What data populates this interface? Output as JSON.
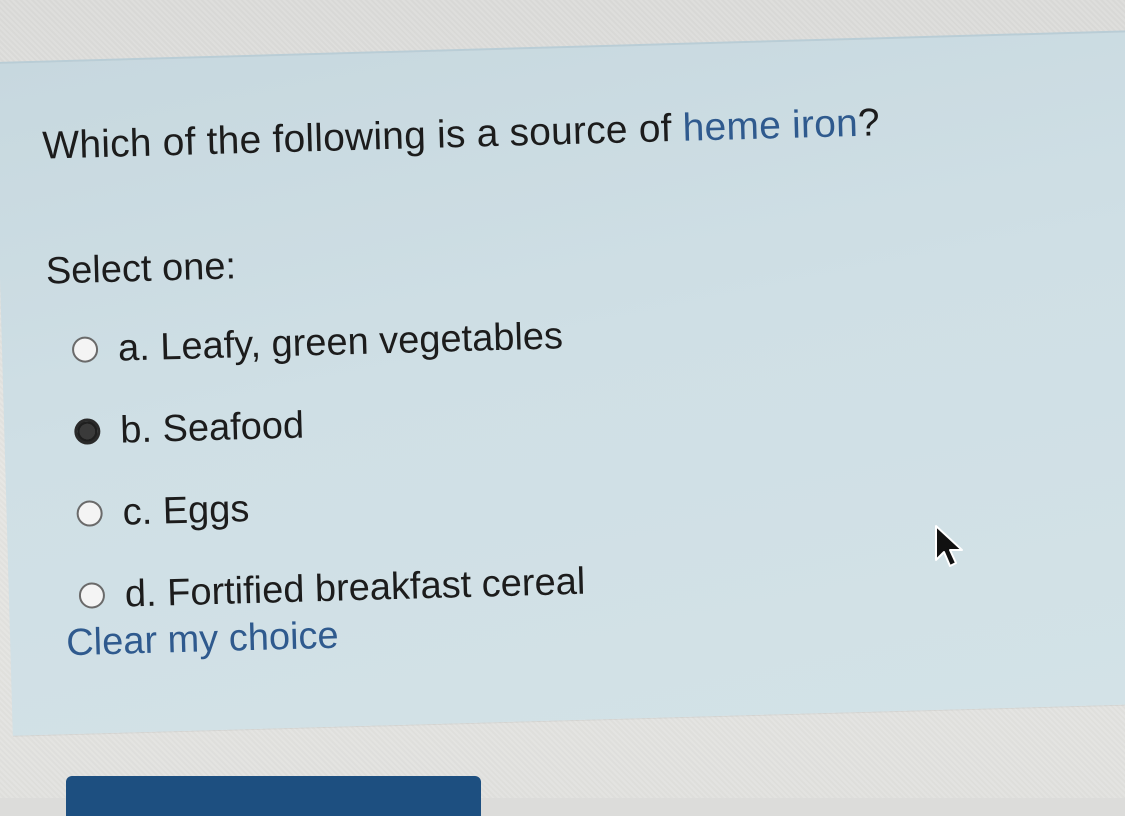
{
  "question": {
    "text_before": "Which of the following is a source of ",
    "link_text": "heme iron",
    "text_after": "?"
  },
  "prompt": "Select one:",
  "options": [
    {
      "label": "a. Leafy, green vegetables",
      "selected": false
    },
    {
      "label": "b. Seafood",
      "selected": true
    },
    {
      "label": "c. Eggs",
      "selected": false
    },
    {
      "label": "d. Fortified breakfast cereal",
      "selected": false
    }
  ],
  "clear_label": "Clear my choice",
  "colors": {
    "card_background": "#cfdfe5",
    "link": "#2f5a8e",
    "button": "#1d4f80"
  },
  "icons": {
    "cursor": "arrow-pointer-icon"
  }
}
